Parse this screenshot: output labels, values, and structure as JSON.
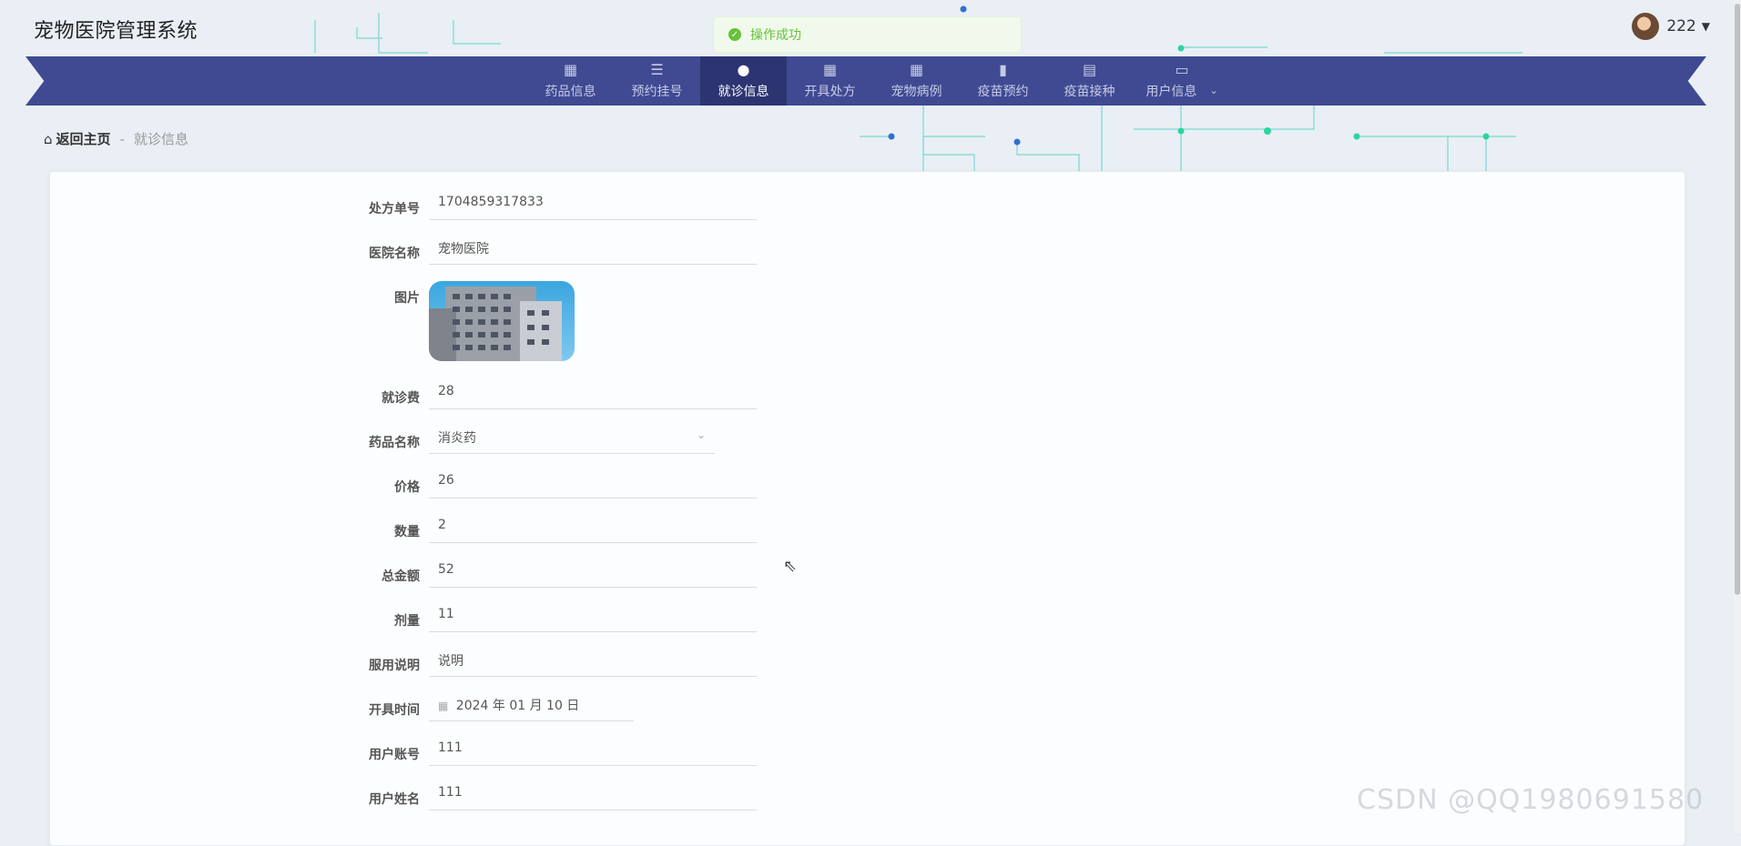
{
  "app": {
    "title": "宠物医院管理系统"
  },
  "toast": {
    "message": "操作成功"
  },
  "user": {
    "name": "222"
  },
  "nav": {
    "items": [
      {
        "label": "药品信息",
        "icon": "grid-icon"
      },
      {
        "label": "预约挂号",
        "icon": "list-icon"
      },
      {
        "label": "就诊信息",
        "icon": "lightbulb-icon",
        "active": true
      },
      {
        "label": "开具处方",
        "icon": "grid-icon"
      },
      {
        "label": "宠物病例",
        "icon": "grid-icon"
      },
      {
        "label": "疫苗预约",
        "icon": "book-icon"
      },
      {
        "label": "疫苗接种",
        "icon": "clipboard-icon"
      },
      {
        "label": "用户信息",
        "icon": "card-icon",
        "has_dropdown": true
      }
    ]
  },
  "breadcrumb": {
    "home": "返回主页",
    "separator": "-",
    "current": "就诊信息"
  },
  "form": {
    "prescription_no": {
      "label": "处方单号",
      "value": "1704859317833"
    },
    "hospital_name": {
      "label": "医院名称",
      "value": "宠物医院"
    },
    "image": {
      "label": "图片"
    },
    "visit_fee": {
      "label": "就诊费",
      "value": "28"
    },
    "drug_name": {
      "label": "药品名称",
      "value": "消炎药"
    },
    "price": {
      "label": "价格",
      "value": "26"
    },
    "quantity": {
      "label": "数量",
      "value": "2"
    },
    "total": {
      "label": "总金额",
      "value": "52"
    },
    "dosage": {
      "label": "剂量",
      "value": "11"
    },
    "instructions": {
      "label": "服用说明",
      "value": "说明"
    },
    "issue_time": {
      "label": "开具时间",
      "value": "2024 年 01 月 10 日"
    },
    "account": {
      "label": "用户账号",
      "value": "111"
    },
    "username": {
      "label": "用户姓名",
      "value": "111"
    }
  },
  "watermark": "CSDN @QQ1980691580",
  "colors": {
    "nav_bg": "#3f4a92",
    "nav_active": "#2c3572",
    "success": "#67c23a"
  }
}
